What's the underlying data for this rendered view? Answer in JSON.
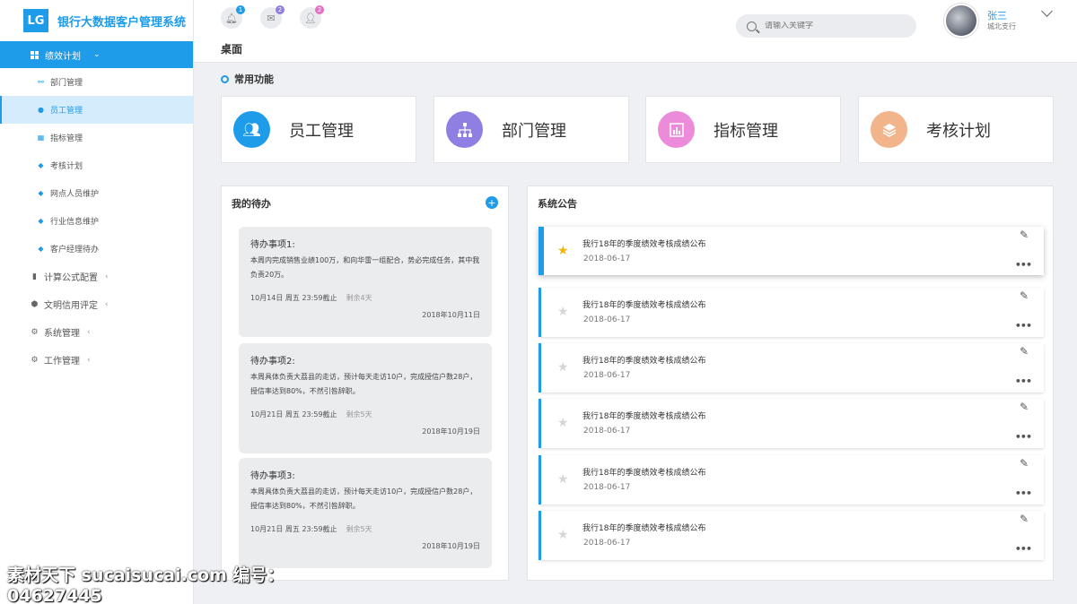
{
  "app": {
    "logo": "LG",
    "title": "银行大数据客户管理系统"
  },
  "sidebar": {
    "active_group": "绩效计划",
    "sub_items": [
      {
        "label": "部门管理",
        "icon": "sitemap-icon",
        "active": false
      },
      {
        "label": "员工管理",
        "icon": "users-icon",
        "active": true
      },
      {
        "label": "指标管理",
        "icon": "chart-icon",
        "active": false
      },
      {
        "label": "考核计划",
        "icon": "layers-icon",
        "active": false
      },
      {
        "label": "网点人员维护",
        "icon": "layers-icon",
        "active": false
      },
      {
        "label": "行业信息维护",
        "icon": "layers-icon",
        "active": false
      },
      {
        "label": "客户经理待办",
        "icon": "layers-icon",
        "active": false
      }
    ],
    "groups": [
      {
        "label": "计算公式配置",
        "icon": "calculator-icon"
      },
      {
        "label": "文明信用评定",
        "icon": "cube-icon"
      },
      {
        "label": "系统管理",
        "icon": "gear-icon"
      },
      {
        "label": "工作管理",
        "icon": "gear-icon"
      }
    ]
  },
  "header": {
    "notifications": [
      {
        "name": "bell",
        "count": "1",
        "color": "#1e9be9"
      },
      {
        "name": "message",
        "count": "2",
        "color": "#8f7fe3"
      },
      {
        "name": "user",
        "count": "2",
        "color": "#e76fc5"
      }
    ],
    "page_title": "桌面",
    "search_placeholder": "请输入关键字",
    "user_name": "张三",
    "user_branch": "城北支行"
  },
  "quick": {
    "title": "常用功能",
    "cards": [
      {
        "label": "员工管理",
        "color": "#1e9be9",
        "icon": "users-icon"
      },
      {
        "label": "部门管理",
        "color": "#8f7fe3",
        "icon": "sitemap-icon"
      },
      {
        "label": "指标管理",
        "color": "#ec8bd9",
        "icon": "chart-icon"
      },
      {
        "label": "考核计划",
        "color": "#f2b48a",
        "icon": "layers-icon"
      }
    ]
  },
  "todo": {
    "title": "我的待办",
    "items": [
      {
        "title": "待办事项1:",
        "body": "本周内完成销售业绩100万，和向华雷一组配合，势必完成任务，其中我负责20万。",
        "deadline": "10月14日  周五 23:59截止",
        "remain": "剩余4天",
        "date": "2018年10月11日"
      },
      {
        "title": "待办事项2:",
        "body": "本周具体负责大荔县的走访，预计每天走访10户，完成授信户数28户，授信率达到80%，不然引咎辞职。",
        "deadline": "10月21日  周五 23:59截止",
        "remain": "剩余5天",
        "date": "2018年10月19日"
      },
      {
        "title": "待办事项3:",
        "body": "本周具体负责大荔县的走访，预计每天走访10户，完成授信户数28户，授信率达到80%，不然引咎辞职。",
        "deadline": "10月21日  周五 23:59截止",
        "remain": "剩余5天",
        "date": "2018年10月19日"
      }
    ]
  },
  "notices": {
    "title": "系统公告",
    "items": [
      {
        "title": "我行18年的季度绩效考核成绩公布",
        "date": "2018-06-17",
        "starred": true
      },
      {
        "title": "我行18年的季度绩效考核成绩公布",
        "date": "2018-06-17",
        "starred": false
      },
      {
        "title": "我行18年的季度绩效考核成绩公布",
        "date": "2018-06-17",
        "starred": false
      },
      {
        "title": "我行18年的季度绩效考核成绩公布",
        "date": "2018-06-17",
        "starred": false
      },
      {
        "title": "我行18年的季度绩效考核成绩公布",
        "date": "2018-06-17",
        "starred": false
      },
      {
        "title": "我行18年的季度绩效考核成绩公布",
        "date": "2018-06-17",
        "starred": false
      }
    ]
  },
  "watermark": "素材天下 sucaisucai.com  编号：04627445"
}
